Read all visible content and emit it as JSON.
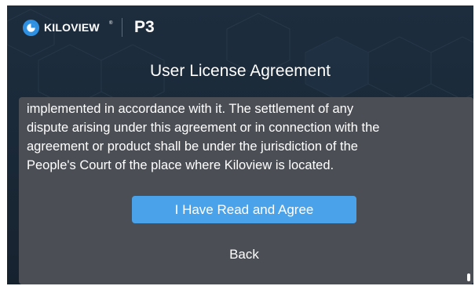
{
  "header": {
    "brand": "KILOVIEW",
    "brand_mark": "®",
    "product": "P3",
    "logo_icon": "kiloview-logo-icon"
  },
  "dialog": {
    "title": "User License Agreement",
    "agreement_text": "implemented in accordance with it. The settlement of any\ndispute arising under this agreement or in connection with the\nagreement or product shall be under the jurisdiction of the\nPeople's Court of the place where Kiloview is located.",
    "agree_label": "I Have Read and Agree",
    "back_label": "Back"
  },
  "colors": {
    "background": "#1b2a39",
    "panel": "#4b4f55",
    "accent": "#4aa3ea",
    "logo_blue": "#2f8fe0",
    "text": "#ffffff"
  }
}
